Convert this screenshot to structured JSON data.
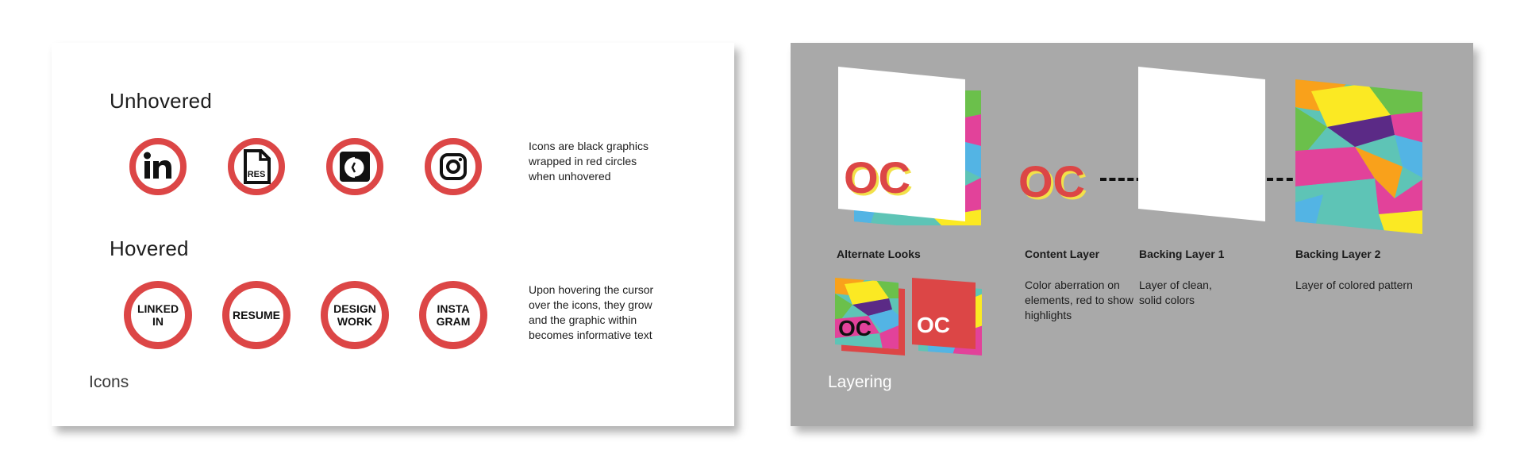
{
  "icons_card": {
    "unhovered_heading": "Unhovered",
    "hovered_heading": "Hovered",
    "unhovered_icons": [
      {
        "icon": "linkedin-icon",
        "text": "in"
      },
      {
        "icon": "resume-file-icon",
        "text": "RES"
      },
      {
        "icon": "design-work-icon",
        "text": ""
      },
      {
        "icon": "instagram-icon",
        "text": ""
      }
    ],
    "hovered_icons": [
      {
        "label": "LINKED\nIN"
      },
      {
        "label": "RESUME"
      },
      {
        "label": "DESIGN\nWORK"
      },
      {
        "label": "INSTA\nGRAM"
      }
    ],
    "unhovered_note": "Icons are black graphics wrapped in red circles when unhovered",
    "hovered_note": "Upon hovering the cursor over the icons, they grow and the graphic within becomes informative text",
    "title": "Icons"
  },
  "layering_card": {
    "logo_text": "OC",
    "alternate_looks_label": "Alternate Looks",
    "content_layer_label": "Content Layer",
    "content_layer_desc": "Color aberration on elements, red to show highlights",
    "backing1_label": "Backing Layer 1",
    "backing1_desc": "Layer of clean, solid colors",
    "backing2_label": "Backing Layer 2",
    "backing2_desc": "Layer of colored pattern",
    "title": "Layering"
  },
  "colors": {
    "accent_red": "#dc4646",
    "card_gray": "#a9a9a9",
    "pattern": [
      "#fbe923",
      "#6bc04b",
      "#e2429a",
      "#53b4e4",
      "#f9a11b",
      "#5ec4b6",
      "#5b2a86"
    ]
  }
}
